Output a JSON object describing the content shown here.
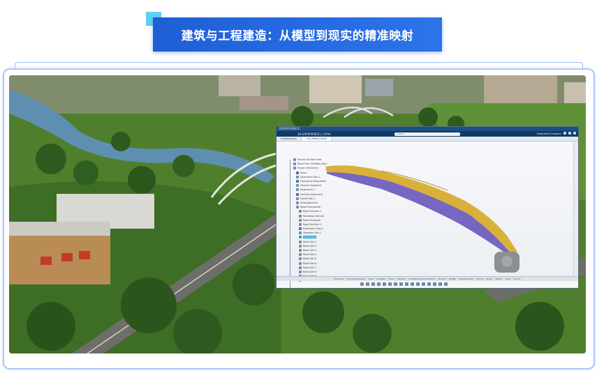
{
  "title": "建筑与工程建造：从模型到现实的精准映射",
  "cad": {
    "window_title": "3DEXPERIENCE",
    "app_name": "3D EXPERIENCE | CATIA",
    "search_placeholder": "Search",
    "user": "Experience Explorer",
    "tabs": [
      "Collaboration",
      "City_Model_Road"
    ],
    "tree": [
      {
        "label": "Terrain Surface Bed",
        "kind": "normal"
      },
      {
        "label": "Road Tree 'Window_Dev'",
        "kind": "normal"
      },
      {
        "label": "Frozen Geometry",
        "kind": "normal"
      },
      {
        "label": "Road",
        "kind": "blue"
      },
      {
        "label": "Alignment Set.1",
        "kind": "normal"
      },
      {
        "label": "Horizontal Alignment",
        "kind": "blue"
      },
      {
        "label": "Vertical Segment",
        "kind": "normal"
      },
      {
        "label": "Alignment.1",
        "kind": "normal"
      },
      {
        "label": "Vertical Alignment",
        "kind": "blue"
      },
      {
        "label": "Profile Set.1",
        "kind": "normal"
      },
      {
        "label": "Arrangements",
        "kind": "normal"
      },
      {
        "label": "Road Framework",
        "kind": "normal"
      },
      {
        "label": "Road Section.1",
        "kind": "normal"
      },
      {
        "label": "Roadway Section",
        "kind": "normal"
      },
      {
        "label": "Road Surfaces",
        "kind": "normal"
      },
      {
        "label": "Road Section.1",
        "kind": "normal"
      },
      {
        "label": "Earthwork Tool.1",
        "kind": "blue"
      },
      {
        "label": "Segment Set.1",
        "kind": "normal"
      },
      {
        "label": "Geometry",
        "kind": "selected"
      },
      {
        "label": "Road Set.1",
        "kind": "normal"
      },
      {
        "label": "Road Set.2",
        "kind": "normal"
      },
      {
        "label": "Road Set.3",
        "kind": "normal"
      },
      {
        "label": "Road Set.4",
        "kind": "normal"
      },
      {
        "label": "Road Set.5",
        "kind": "normal"
      },
      {
        "label": "Road Set.6",
        "kind": "normal"
      },
      {
        "label": "Road Set.7",
        "kind": "normal"
      },
      {
        "label": "Road Set.8",
        "kind": "normal"
      },
      {
        "label": "Road Set.9",
        "kind": "normal"
      },
      {
        "label": "Clearing Plane Set",
        "kind": "normal"
      }
    ],
    "bottom_tabs": [
      "Standard",
      "Civil Engineering",
      "View",
      "Analysis",
      "Tools",
      "Markup",
      "Architecture and Surface",
      "Terrain",
      "Bridge",
      "Geotechnical",
      "Tunnel",
      "Road",
      "AR-VR",
      "Tools",
      "Touch"
    ]
  }
}
